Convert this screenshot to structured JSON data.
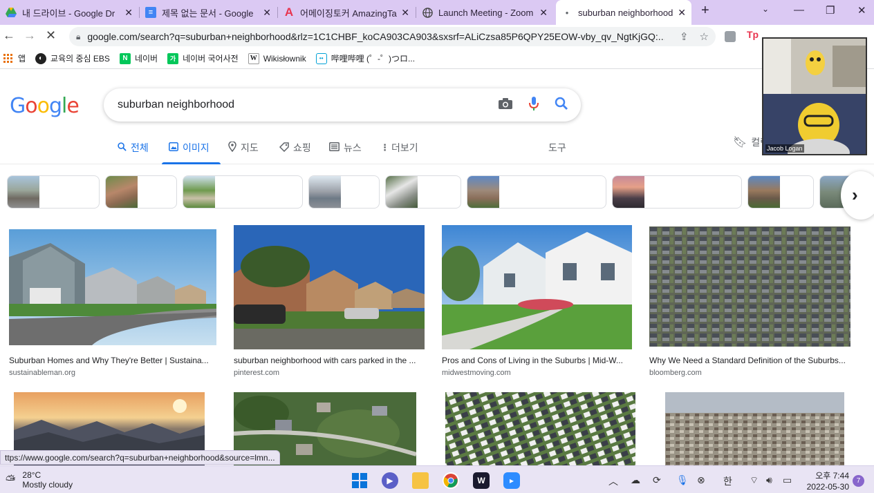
{
  "browser": {
    "tabs": [
      {
        "title": "내 드라이브 - Google Dr",
        "icon": "google-drive-icon"
      },
      {
        "title": "제목 없는 문서 - Google",
        "icon": "google-docs-icon"
      },
      {
        "title": "어메이징토커 AmazingTa",
        "icon": "amazingtalker-icon"
      },
      {
        "title": "Launch Meeting - Zoom",
        "icon": "globe-icon"
      },
      {
        "title": "suburban neighborhood",
        "icon": "loading-dot-icon"
      }
    ],
    "url": "google.com/search?q=suburban+neighborhood&rlz=1C1CHBF_koCA903CA903&sxsrf=ALiCzsa85P6QPY25EOW-vby_qv_NgtKjGQ:...",
    "bookmarks": [
      {
        "label": "앱",
        "icon": "apps-grid-icon"
      },
      {
        "label": "교육의 중심 EBS",
        "icon": "ebs-icon"
      },
      {
        "label": "네이버",
        "icon": "naver-icon"
      },
      {
        "label": "네이버 국어사전",
        "icon": "naver-dictionary-icon"
      },
      {
        "label": "Wikisłownik",
        "icon": "wiki-icon"
      },
      {
        "label": "哔哩哔哩 (゜-゜)つロ...",
        "icon": "bilibili-icon"
      }
    ]
  },
  "google": {
    "logo": "Google",
    "query": "suburban neighborhood",
    "tabs": [
      {
        "label": "전체",
        "icon": "search-icon"
      },
      {
        "label": "이미지",
        "icon": "image-icon"
      },
      {
        "label": "지도",
        "icon": "map-pin-icon"
      },
      {
        "label": "쇼핑",
        "icon": "tag-icon"
      },
      {
        "label": "뉴스",
        "icon": "news-icon"
      },
      {
        "label": "더보기",
        "icon": "more-vert-icon"
      }
    ],
    "tools": "도구",
    "collections": "컬렉",
    "results": [
      {
        "caption": "Suburban Homes and Why They're Better | Sustaina...",
        "source": "sustainableman.org"
      },
      {
        "caption": "suburban neighborhood with cars parked in the ...",
        "source": "pinterest.com"
      },
      {
        "caption": "Pros and Cons of Living in the Suburbs | Mid-W...",
        "source": "midwestmoving.com"
      },
      {
        "caption": "Why We Need a Standard Definition of the Suburbs...",
        "source": "bloomberg.com"
      }
    ]
  },
  "status_url": "ttps://www.google.com/search?q=suburban+neighborhood&source=lmn...",
  "zoom": {
    "participant": "Jacob Logan"
  },
  "taskbar": {
    "temperature": "28°C",
    "weather": "Mostly cloudy",
    "ime": "한",
    "time": "오후 7:44",
    "date": "2022-05-30",
    "notifications": "7"
  }
}
